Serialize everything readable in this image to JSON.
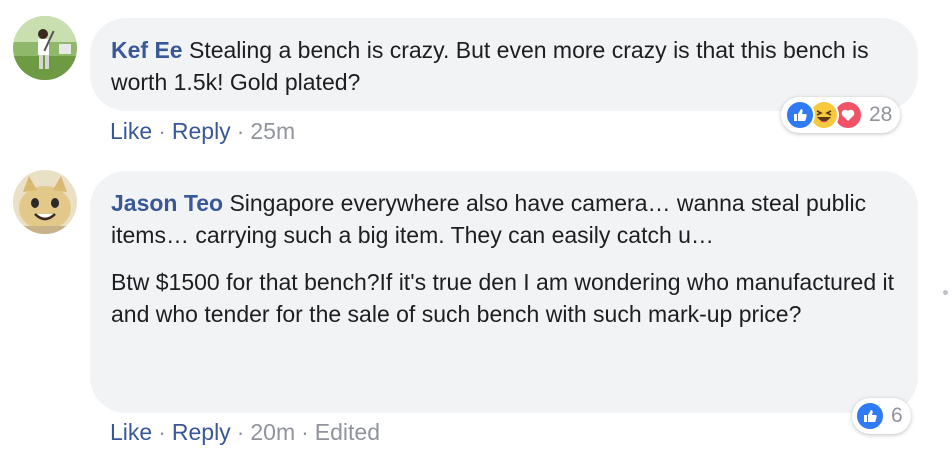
{
  "comments": [
    {
      "author": "Kef Ee",
      "paragraphs": [
        "Stealing a bench is crazy. But even more crazy is that this bench is worth 1.5k! Gold plated?"
      ],
      "like_label": "Like",
      "reply_label": "Reply",
      "time": "25m",
      "reaction_icons": [
        "like-reaction-icon",
        "haha-reaction-icon",
        "love-reaction-icon"
      ],
      "reaction_count": "28"
    },
    {
      "author": "Jason Teo",
      "paragraphs": [
        "Singapore everywhere also have camera… wanna steal public items… carrying such a big item. They can easily catch u…",
        "Btw $1500 for that bench?If it's true den I am wondering who manufactured it and who tender for the sale of such bench with such mark-up price?"
      ],
      "like_label": "Like",
      "reply_label": "Reply",
      "time": "20m",
      "edited_label": "Edited",
      "reaction_icons": [
        "like-reaction-icon"
      ],
      "reaction_count": "6"
    }
  ],
  "separator": "·",
  "colors": {
    "link": "#385898",
    "bubble": "#f2f3f5",
    "meta": "#90949c",
    "like_reaction": "#2f7bf5",
    "haha_reaction": "#f7c93e",
    "love_reaction": "#f25268"
  }
}
